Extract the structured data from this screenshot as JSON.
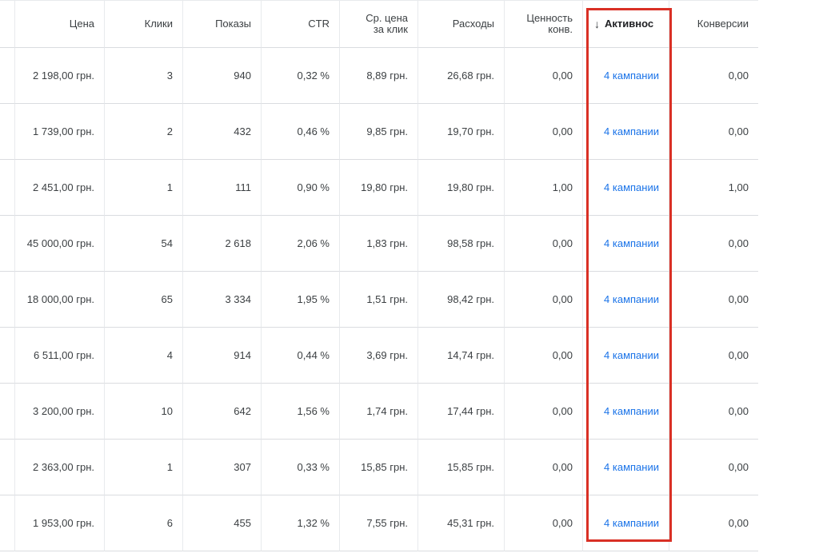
{
  "highlight_color": "#d93025",
  "link_color": "#1a73e8",
  "header": {
    "price": "Цена",
    "clicks": "Клики",
    "impressions": "Показы",
    "ctr": "CTR",
    "avg_cpc": "Ср. цена за клик",
    "cost": "Расходы",
    "conv_value": "Ценность конв.",
    "activity": "Активнос",
    "conversions": "Конверсии",
    "sort_icon": "arrow-down-icon"
  },
  "rows": [
    {
      "price": "2 198,00 грн.",
      "clicks": "3",
      "impressions": "940",
      "ctr": "0,32 %",
      "avg_cpc": "8,89 грн.",
      "cost": "26,68 грн.",
      "conv_value": "0,00",
      "activity": "4 кампании",
      "conversions": "0,00"
    },
    {
      "price": "1 739,00 грн.",
      "clicks": "2",
      "impressions": "432",
      "ctr": "0,46 %",
      "avg_cpc": "9,85 грн.",
      "cost": "19,70 грн.",
      "conv_value": "0,00",
      "activity": "4 кампании",
      "conversions": "0,00"
    },
    {
      "price": "2 451,00 грн.",
      "clicks": "1",
      "impressions": "111",
      "ctr": "0,90 %",
      "avg_cpc": "19,80 грн.",
      "cost": "19,80 грн.",
      "conv_value": "1,00",
      "activity": "4 кампании",
      "conversions": "1,00"
    },
    {
      "price": "45 000,00 грн.",
      "clicks": "54",
      "impressions": "2 618",
      "ctr": "2,06 %",
      "avg_cpc": "1,83 грн.",
      "cost": "98,58 грн.",
      "conv_value": "0,00",
      "activity": "4 кампании",
      "conversions": "0,00"
    },
    {
      "price": "18 000,00 грн.",
      "clicks": "65",
      "impressions": "3 334",
      "ctr": "1,95 %",
      "avg_cpc": "1,51 грн.",
      "cost": "98,42 грн.",
      "conv_value": "0,00",
      "activity": "4 кампании",
      "conversions": "0,00"
    },
    {
      "price": "6 511,00 грн.",
      "clicks": "4",
      "impressions": "914",
      "ctr": "0,44 %",
      "avg_cpc": "3,69 грн.",
      "cost": "14,74 грн.",
      "conv_value": "0,00",
      "activity": "4 кампании",
      "conversions": "0,00"
    },
    {
      "price": "3 200,00 грн.",
      "clicks": "10",
      "impressions": "642",
      "ctr": "1,56 %",
      "avg_cpc": "1,74 грн.",
      "cost": "17,44 грн.",
      "conv_value": "0,00",
      "activity": "4 кампании",
      "conversions": "0,00"
    },
    {
      "price": "2 363,00 грн.",
      "clicks": "1",
      "impressions": "307",
      "ctr": "0,33 %",
      "avg_cpc": "15,85 грн.",
      "cost": "15,85 грн.",
      "conv_value": "0,00",
      "activity": "4 кампании",
      "conversions": "0,00"
    },
    {
      "price": "1 953,00 грн.",
      "clicks": "6",
      "impressions": "455",
      "ctr": "1,32 %",
      "avg_cpc": "7,55 грн.",
      "cost": "45,31 грн.",
      "conv_value": "0,00",
      "activity": "4 кампании",
      "conversions": "0,00"
    }
  ]
}
